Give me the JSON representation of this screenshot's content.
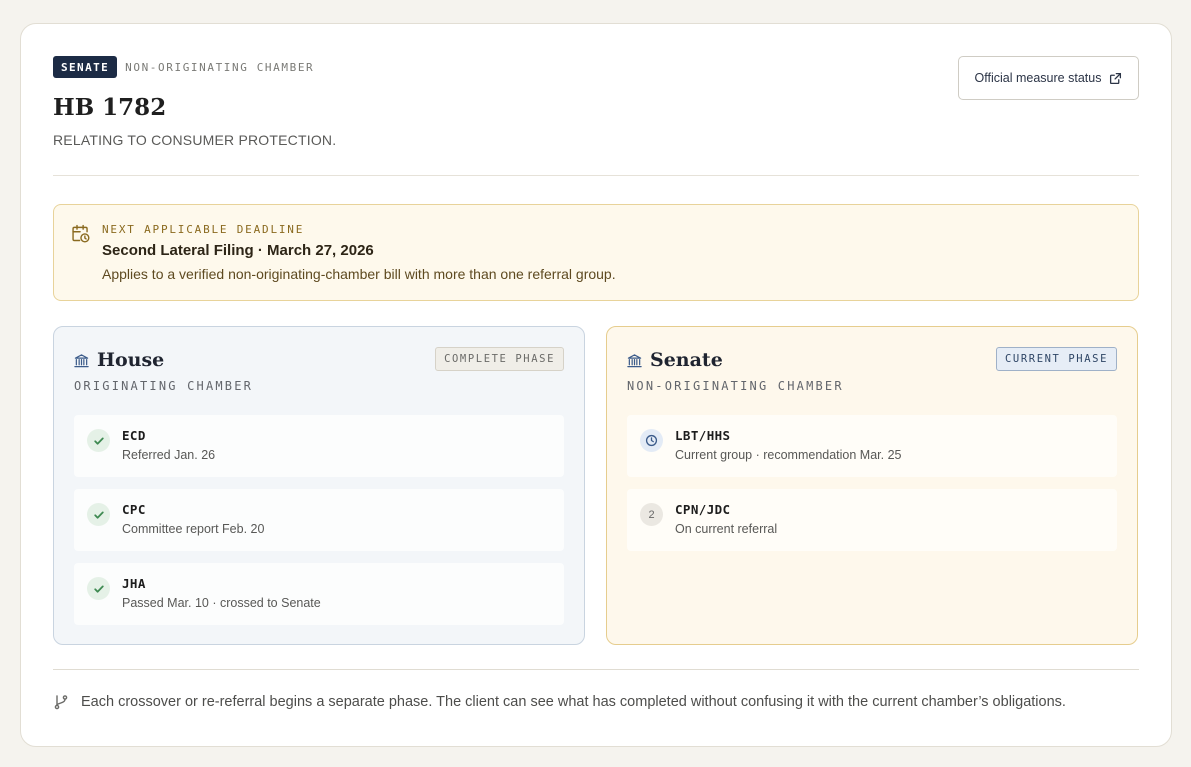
{
  "header": {
    "chamber_badge": "SENATE",
    "chamber_kicker": "NON-ORIGINATING CHAMBER",
    "bill_number": "HB 1782",
    "bill_title": "RELATING TO CONSUMER PROTECTION.",
    "status_link_label": "Official measure status",
    "status_link_icon": "external-link-icon"
  },
  "deadline": {
    "icon": "calendar-clock-icon",
    "kicker": "NEXT APPLICABLE DEADLINE",
    "title": "Second Lateral Filing · March 27, 2026",
    "description": "Applies to a verified non-originating-chamber bill with more than one referral group."
  },
  "phases": [
    {
      "name": "House",
      "icon": "capitol-icon",
      "subtitle": "ORIGINATING CHAMBER",
      "badge": "COMPLETE PHASE",
      "items": [
        {
          "code": "ECD",
          "description": "Referred Jan. 26",
          "status": "done",
          "icon": "check-icon"
        },
        {
          "code": "CPC",
          "description": "Committee report Feb. 20",
          "status": "done",
          "icon": "check-icon"
        },
        {
          "code": "JHA",
          "description": "Passed Mar. 10 · crossed to Senate",
          "status": "done",
          "icon": "check-icon"
        }
      ]
    },
    {
      "name": "Senate",
      "icon": "capitol-icon",
      "subtitle": "NON-ORIGINATING CHAMBER",
      "badge": "CURRENT PHASE",
      "items": [
        {
          "code": "LBT/HHS",
          "description": "Current group · recommendation Mar. 25",
          "status": "current",
          "icon": "clock-icon"
        },
        {
          "code": "CPN/JDC",
          "description": "On current referral",
          "status": "pending",
          "marker": "2"
        }
      ]
    }
  ],
  "footer": {
    "icon": "branch-icon",
    "text": "Each crossover or re-referral begins a separate phase. The client can see what has completed without confusing it with the current chamber’s obligations."
  },
  "colors": {
    "badge_navy": "#1c2b45",
    "deadline_bg": "#fef9ec",
    "house_bg": "#f3f6f9",
    "senate_bg": "#fef8ec",
    "done_green": "#3f8a52",
    "current_blue": "#3b5b8a"
  }
}
